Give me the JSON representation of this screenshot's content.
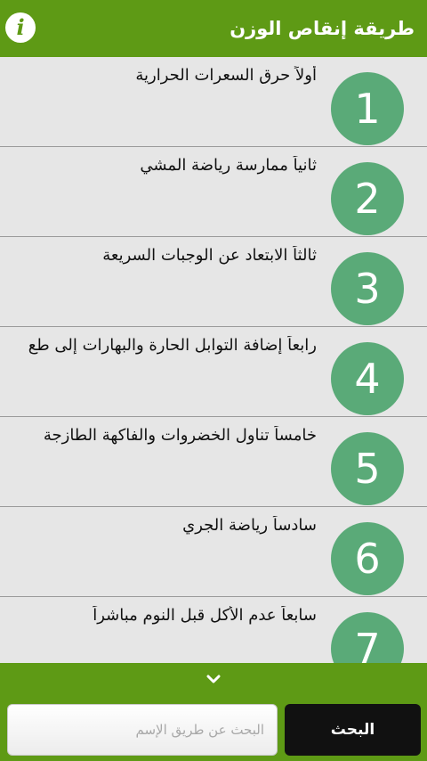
{
  "header": {
    "title": "طريقة إنقاص الوزن",
    "info_icon": "i"
  },
  "list": {
    "items": [
      {
        "number": "1",
        "text": "أولاً حرق السعرات الحرارية"
      },
      {
        "number": "2",
        "text": "ثانياً ممارسة رياضة المشي"
      },
      {
        "number": "3",
        "text": "ثالثاً الابتعاد عن الوجبات السريعة"
      },
      {
        "number": "4",
        "text": "رابعاً إضافة التوابل الحارة والبهارات إلى طع"
      },
      {
        "number": "5",
        "text": "خامساً تناول الخضروات والفاكهة الطازجة"
      },
      {
        "number": "6",
        "text": "سادساً رياضة الجري"
      },
      {
        "number": "7",
        "text": "سابعاً عدم الأكل قبل النوم مباشراً"
      }
    ]
  },
  "footer": {
    "expand_icon": "chevron-down-icon",
    "search_placeholder": "البحث عن طريق الإسم",
    "search_button": "البحث"
  },
  "colors": {
    "header_green": "#5e9a15",
    "circle_green": "#5aaa78",
    "list_bg": "#e6e6e6",
    "button_black": "#111111"
  }
}
